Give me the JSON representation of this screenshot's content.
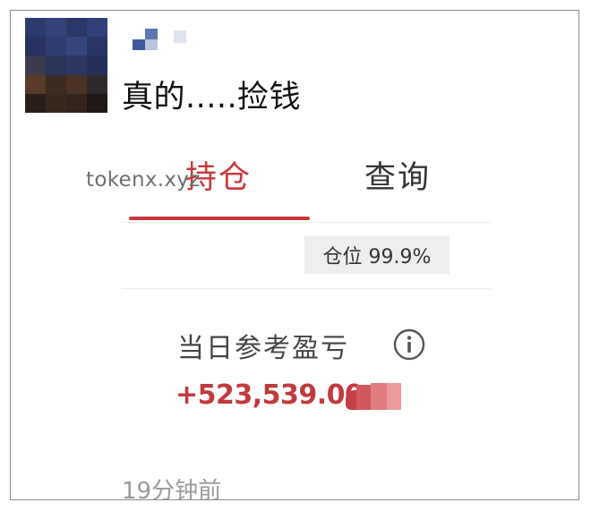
{
  "post": {
    "text": "真的.....捡钱"
  },
  "tabs": [
    {
      "label": "持仓",
      "active": true
    },
    {
      "label": "查询",
      "active": false
    }
  ],
  "watermark": "tokenx.xyz",
  "position_badge": "仓位 99.9%",
  "pnl": {
    "label": "当日参考盈亏",
    "value": "+523,539.00"
  },
  "timestamp": "19分钟前",
  "colors": {
    "accent": "#c8383c",
    "profit": "#c0393d"
  },
  "icons": {
    "info": "info-icon"
  }
}
